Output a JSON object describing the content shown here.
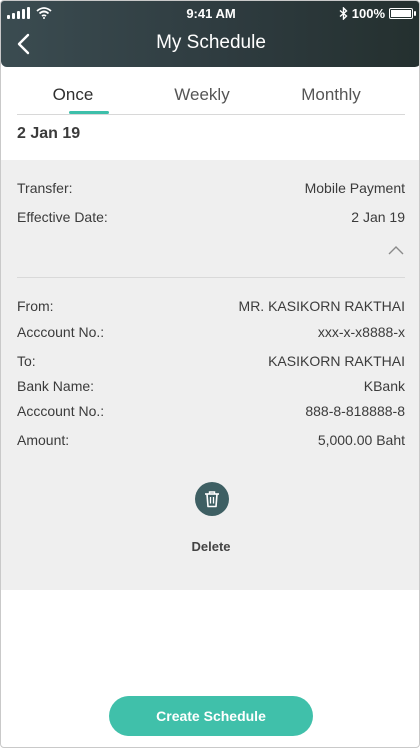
{
  "status_bar": {
    "time": "9:41 AM",
    "battery": "100%"
  },
  "header": {
    "title": "My Schedule"
  },
  "tabs": [
    {
      "label": "Once"
    },
    {
      "label": "Weekly"
    },
    {
      "label": "Monthly"
    }
  ],
  "selected_date": "2 Jan 19",
  "summary": {
    "transfer_label": "Transfer:",
    "transfer_value": "Mobile Payment",
    "effective_label": "Effective Date:",
    "effective_value": "2 Jan 19"
  },
  "details": {
    "from_label": "From:",
    "from_value": "MR. KASIKORN RAKTHAI",
    "from_account_label": "Acccount No.:",
    "from_account_value": "xxx-x-x8888-x",
    "to_label": "To:",
    "to_value": "KASIKORN RAKTHAI",
    "bank_label": "Bank Name:",
    "bank_value": "KBank",
    "to_account_label": "Acccount No.:",
    "to_account_value": "888-8-818888-8",
    "amount_label": "Amount:",
    "amount_value": "5,000.00 Baht"
  },
  "actions": {
    "delete_label": "Delete",
    "create_label": "Create Schedule"
  },
  "colors": {
    "accent": "#40c0aa",
    "header": "#2e3b3f",
    "delete": "#3e5f63",
    "card": "#efefef"
  }
}
